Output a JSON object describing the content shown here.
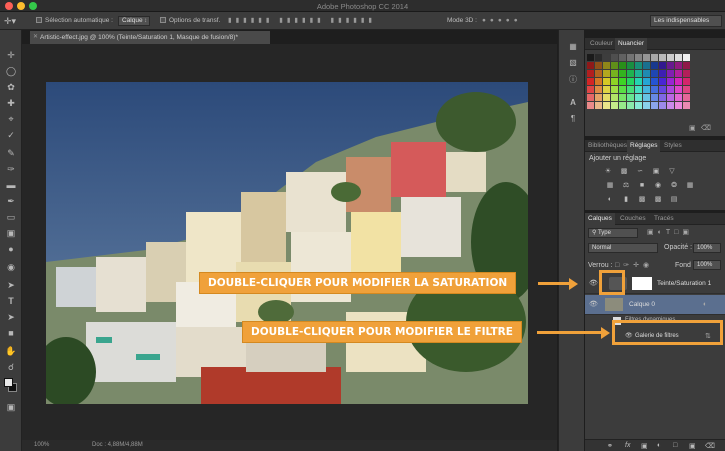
{
  "window": {
    "title": "Adobe Photoshop CC 2014",
    "traffic_colors": [
      "#fc5f57",
      "#fdbc2e",
      "#34c84a"
    ]
  },
  "options_bar": {
    "auto_select_label": "Sélection automatique :",
    "auto_select_value": "Calque",
    "transform_label": "Options de transf.",
    "mode3d_label": "Mode 3D :",
    "workspace": "Les indispensables"
  },
  "tools": [
    "move-tool",
    "marquee-tool",
    "lasso-tool",
    "quick-select-tool",
    "crop-tool",
    "eyedropper-tool",
    "healing-tool",
    "brush-tool",
    "stamp-tool",
    "history-brush-tool",
    "eraser-tool",
    "gradient-tool",
    "blur-tool",
    "dodge-tool",
    "pen-tool",
    "type-tool",
    "path-select-tool",
    "shape-tool",
    "hand-tool",
    "zoom-tool"
  ],
  "document": {
    "tab_title": "Artistic-effect.jpg @ 100% (Teinte/Saturation 1, Masque de fusion/8)*",
    "zoom": "100%",
    "doc_info": "Doc : 4,88M/4,88M"
  },
  "color_panel": {
    "tabs": [
      "Couleur",
      "Nuancier"
    ],
    "active_tab": "Nuancier"
  },
  "adjustments_panel": {
    "tabs": [
      "Bibliothèques",
      "Réglages",
      "Styles"
    ],
    "active_tab": "Réglages",
    "title": "Ajouter un réglage"
  },
  "layers_panel": {
    "tabs": [
      "Calques",
      "Couches",
      "Tracés"
    ],
    "active_tab": "Calques",
    "filter": "Type",
    "blend_mode": "Normal",
    "opacity_label": "Opacité :",
    "opacity_value": "100%",
    "lock_label": "Verrou :",
    "fill_label": "Fond :",
    "fill_value": "100%",
    "layers": [
      {
        "name": "Teinte/Saturation 1",
        "kind": "adjustment"
      },
      {
        "name": "Calque 0",
        "kind": "smart-object",
        "selected": true
      },
      {
        "name": "Filtres dynamiques",
        "kind": "smart-filters"
      },
      {
        "name": "Galerie de filtres",
        "kind": "filter"
      }
    ]
  },
  "callouts": {
    "saturation": "DOUBLE-CLIQUER POUR MODIFIER LA SATURATION",
    "filter": "DOUBLE-CLIQUER POUR MODIFIER LE FILTRE"
  },
  "accent_color": "#f0a13a"
}
